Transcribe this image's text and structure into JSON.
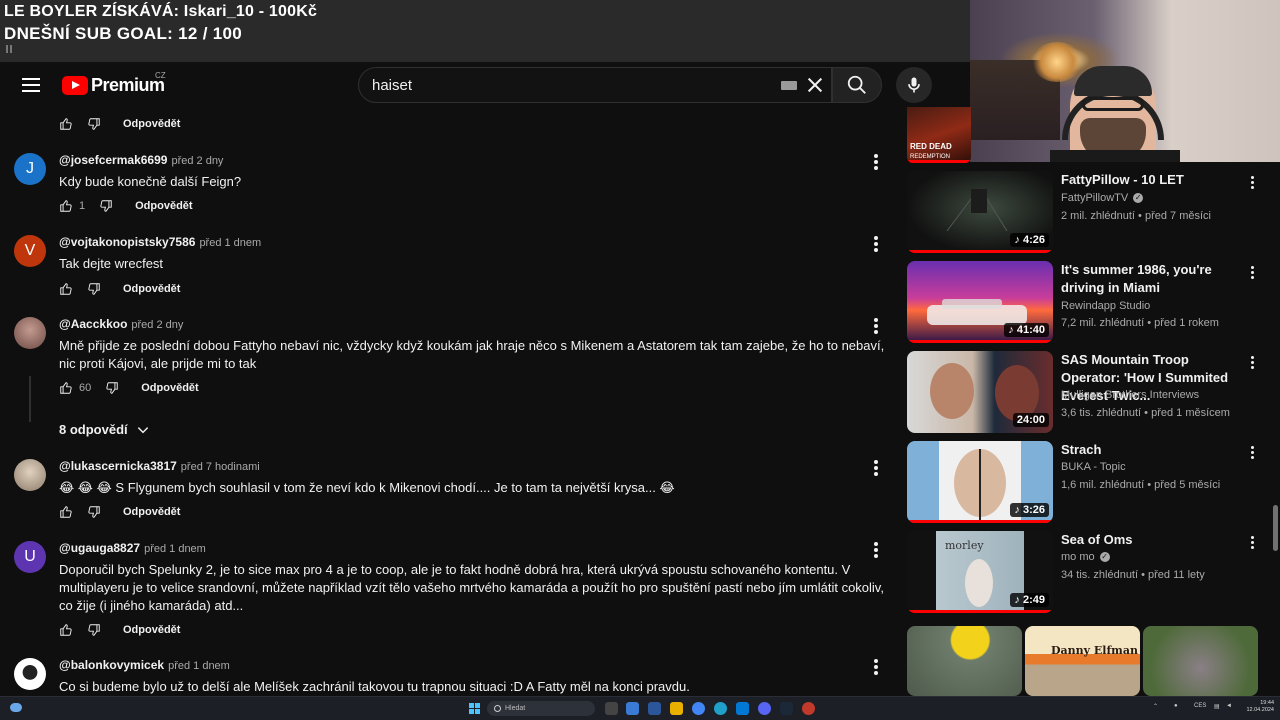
{
  "overlay": {
    "line1": "LE BOYLER ZÍSKÁVÁ: Iskari_10 - 100Kč",
    "line2": "DNEŠNÍ SUB GOAL: 12 / 100"
  },
  "header": {
    "logo_text": "Premium",
    "country_code": "CZ",
    "search_value": "haiset"
  },
  "comments": {
    "reply_label": "Odpovědět",
    "items": [
      {
        "author": "@josefcermak6699",
        "time": "před 2 dny",
        "avatar_letter": "J",
        "avatar_color": "#1a73c8",
        "text": "Kdy bude konečně další Feign?",
        "likes": "1"
      },
      {
        "author": "@vojtakonopistsky7586",
        "time": "před 1 dnem",
        "avatar_letter": "V",
        "avatar_color": "#bf360c",
        "text": "Tak dejte wrecfest",
        "likes": ""
      },
      {
        "author": "@Aacckkoo",
        "time": "před 2 dny",
        "avatar_letter": "",
        "avatar_color": "#8a6a62",
        "text": "Mně přijde ze poslední dobou Fattyho nebaví nic, vždycky když koukám jak hraje něco s Mikenem a Astatorem tak tam zajebe, že ho to nebaví, nic proti Kájovi, ale prijde mi to tak",
        "likes": "60",
        "replies": "8 odpovědí"
      },
      {
        "author": "@lukascernicka3817",
        "time": "před 7 hodinami",
        "avatar_letter": "",
        "avatar_color": "#c9b7a0",
        "text": "😂 😂 😂 S Flygunem bych souhlasil v tom že neví kdo k  Mikenovi chodí.... Je to tam ta největší krysa... 😂",
        "likes": ""
      },
      {
        "author": "@ugauga8827",
        "time": "před 1 dnem",
        "avatar_letter": "U",
        "avatar_color": "#5e35b1",
        "text": "Doporučil bych Spelunky 2, je to sice max pro 4 a je to coop, ale je to fakt hodně dobrá hra, která ukrývá spoustu schovaného kontentu. V multiplayeru je to velice srandovní, můžete například vzít tělo vašeho mrtvého kamaráda a použít ho pro spuštění pastí nebo jím umlátit cokoliv, co žije (i jiného kamaráda) atd...",
        "likes": ""
      },
      {
        "author": "@balonkovymicek",
        "time": "před 1 dnem",
        "avatar_letter": "",
        "avatar_color": "#ffffff",
        "text": "Co si budeme bylo už to delší ale Melíšek zachránil takovou tu trapnou situaci :D A Fatty měl na konci pravdu.",
        "likes": ""
      }
    ]
  },
  "sidebar": {
    "top_thumb_text": "RED DEAD",
    "top_thumb_sub": "REDEMPTION",
    "videos": [
      {
        "title": "FattyPillow - 10 LET",
        "channel": "FattyPillowTV",
        "verified": true,
        "views": "2 mil. zhlédnutí",
        "age": "před 7 měsíci",
        "duration": "4:26"
      },
      {
        "title": "It's summer 1986, you're driving in Miami",
        "channel": "Rewindapp Studio",
        "verified": false,
        "views": "7,2 mil. zhlédnutí",
        "age": "před 1 rokem",
        "duration": "41:40"
      },
      {
        "title": "SAS Mountain Troop Operator: 'How I Summited Everest Twic...",
        "channel": "Mulligan Brothers Interviews",
        "verified": false,
        "views": "3,6 tis. zhlédnutí",
        "age": "před 1 měsícem",
        "duration": "24:00"
      },
      {
        "title": "Strach",
        "channel": "BUKA - Topic",
        "verified": false,
        "views": "1,6 mil. zhlédnutí",
        "age": "před 5 měsíci",
        "duration": "3:26"
      },
      {
        "title": "Sea of Oms",
        "channel": "mo mo",
        "verified": true,
        "views": "34 tis. zhlédnutí",
        "age": "před 11 lety",
        "duration": "2:49"
      }
    ],
    "shorts": [
      {
        "label": ""
      },
      {
        "label": "Danny Elfman"
      },
      {
        "label": ""
      }
    ]
  },
  "taskbar": {
    "search_placeholder": "Hledat",
    "lang": "CES",
    "time": "19:44",
    "date": "12.04.2024"
  }
}
